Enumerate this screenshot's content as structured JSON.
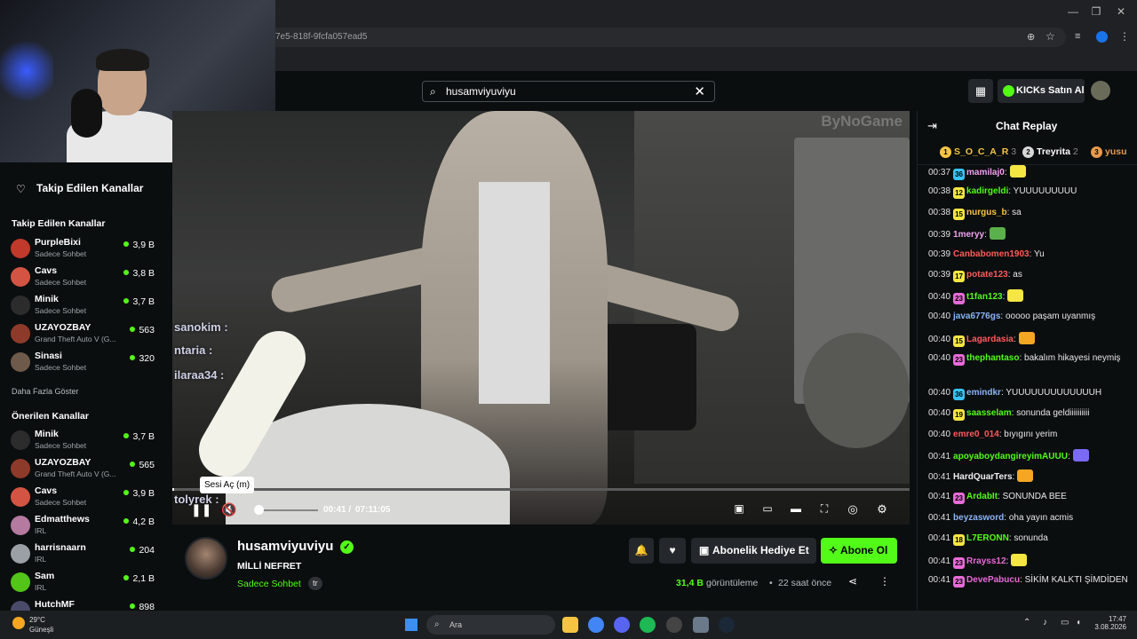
{
  "browser": {
    "url_fragment": "7e5-818f-9fcfa057ead5",
    "window_controls": [
      "—",
      "❐",
      "✕"
    ]
  },
  "header": {
    "search_value": "husamviyuviyu",
    "kicks_label": "KICKs Satın Al"
  },
  "sidebar": {
    "title": "Takip Edilen Kanallar",
    "followed_section": "Takip Edilen Kanallar",
    "followed": [
      {
        "name": "PurpleBixi",
        "sub": "Sadece Sohbet",
        "viewers": "3,9 B"
      },
      {
        "name": "Cavs",
        "sub": "Sadece Sohbet",
        "viewers": "3,8 B"
      },
      {
        "name": "Minik",
        "sub": "Sadece Sohbet",
        "viewers": "3,7 B"
      },
      {
        "name": "UZAYOZBAY",
        "sub": "Grand Theft Auto V (G...",
        "viewers": "563"
      },
      {
        "name": "Sinasi",
        "sub": "Sadece Sohbet",
        "viewers": "320"
      }
    ],
    "show_more": "Daha Fazla Göster",
    "recommended_section": "Önerilen Kanallar",
    "recommended": [
      {
        "name": "Minik",
        "sub": "Sadece Sohbet",
        "viewers": "3,7 B"
      },
      {
        "name": "UZAYOZBAY",
        "sub": "Grand Theft Auto V (G...",
        "viewers": "565"
      },
      {
        "name": "Cavs",
        "sub": "Sadece Sohbet",
        "viewers": "3,9 B"
      },
      {
        "name": "Edmatthews",
        "sub": "IRL",
        "viewers": "4,2 B"
      },
      {
        "name": "harrisnaarn",
        "sub": "IRL",
        "viewers": "204"
      },
      {
        "name": "Sam",
        "sub": "IRL",
        "viewers": "2,1 B"
      },
      {
        "name": "HutchMF",
        "sub": "",
        "viewers": "898"
      }
    ]
  },
  "video": {
    "brand_overlay": "ByNoGame",
    "overlay_chat": [
      "sanokim :",
      "ntaria :",
      "ilaraa34 :",
      "tolyrek :"
    ],
    "tooltip": "Sesi Aç (m)",
    "time_current": "00:41",
    "time_separator": "/",
    "time_total": "07:11:05",
    "progress": 0.002
  },
  "channel": {
    "name": "husamviyuviyu",
    "title": "MİLLİ NEFRET",
    "category": "Sadece Sohbet",
    "language": "tr",
    "gift_label": "Abonelik Hediye Et",
    "subscribe_label": "Abone Ol",
    "views_count": "31,4 B",
    "views_label": "görüntüleme",
    "bullet": "•",
    "ago": "22 saat önce"
  },
  "chat": {
    "title": "Chat Replay",
    "leaderboard": [
      {
        "rank": "1",
        "name": "S_O_C_A_R",
        "count": "3",
        "color": "#f5c542"
      },
      {
        "rank": "2",
        "name": "Treyrita",
        "count": "2",
        "color": "#d8d8d8"
      },
      {
        "rank": "3",
        "name": "yusu",
        "count": "",
        "color": "#e89a4a"
      }
    ],
    "messages": [
      {
        "time": "00:37",
        "badge": "36",
        "badge_color": "#36c3f5",
        "user": "mamilaj0",
        "user_color": "#f0a0f0",
        "text": ":"
      },
      {
        "time": "00:38",
        "badge": "12",
        "badge_color": "#f5e642",
        "user": "kadirgeldi",
        "user_color": "#53fc18",
        "text": ": YUUUUUUUUU"
      },
      {
        "time": "00:38",
        "badge": "15",
        "badge_color": "#f5e642",
        "user": "nurgus_b",
        "user_color": "#f5c542",
        "text": ": sa"
      },
      {
        "time": "00:39",
        "badge": "",
        "badge_color": "",
        "user": "1meryy",
        "user_color": "#f0a0f0",
        "text": ":"
      },
      {
        "time": "00:39",
        "badge": "",
        "badge_color": "",
        "user": "Canbabomen1903",
        "user_color": "#ff5a5a",
        "text": ": Yu"
      },
      {
        "time": "00:39",
        "badge": "17",
        "badge_color": "#f5e642",
        "user": "potate123",
        "user_color": "#ff5a5a",
        "text": ": as"
      },
      {
        "time": "00:40",
        "badge": "23",
        "badge_color": "#e86ad8",
        "user": "t1fan123",
        "user_color": "#53fc18",
        "text": ":"
      },
      {
        "time": "00:40",
        "badge": "",
        "badge_color": "",
        "user": "java6776gs",
        "user_color": "#8ab4f8",
        "text": ": ooooo paşam uyanmış"
      },
      {
        "time": "00:40",
        "badge": "15",
        "badge_color": "#f5e642",
        "user": "Lagardasia",
        "user_color": "#ff5a5a",
        "text": ":"
      },
      {
        "time": "00:40",
        "badge": "23",
        "badge_color": "#e86ad8",
        "user": "thephantaso",
        "user_color": "#53fc18",
        "text": ": bakalım hikayesi neymiş"
      },
      {
        "time": "00:40",
        "badge": "36",
        "badge_color": "#36c3f5",
        "user": "emindkr",
        "user_color": "#8ab4f8",
        "text": ": YUUUUUUUUUUUUUH"
      },
      {
        "time": "00:40",
        "badge": "19",
        "badge_color": "#f5e642",
        "user": "saasselam",
        "user_color": "#53fc18",
        "text": ": sonunda geldiiiiiiiiii"
      },
      {
        "time": "00:40",
        "badge": "",
        "badge_color": "",
        "user": "emre0_014",
        "user_color": "#ff5a5a",
        "text": ": bıyıgını yerim"
      },
      {
        "time": "00:41",
        "badge": "",
        "badge_color": "",
        "user": "apoyaboydangireyimAUUU",
        "user_color": "#53fc18",
        "text": ":"
      },
      {
        "time": "00:41",
        "badge": "",
        "badge_color": "",
        "user": "HardQuarTers",
        "user_color": "#f0f0f0",
        "text": ":"
      },
      {
        "time": "00:41",
        "badge": "23",
        "badge_color": "#e86ad8",
        "user": "ArdabIt",
        "user_color": "#53fc18",
        "text": ": SONUNDA BEE"
      },
      {
        "time": "00:41",
        "badge": "",
        "badge_color": "",
        "user": "beyzasword",
        "user_color": "#8ab4f8",
        "text": ": oha yayın acmis"
      },
      {
        "time": "00:41",
        "badge": "18",
        "badge_color": "#f5e642",
        "user": "L7ERONN",
        "user_color": "#53fc18",
        "text": ": sonunda"
      },
      {
        "time": "00:41",
        "badge": "23",
        "badge_color": "#e86ad8",
        "user": "Rrayss12",
        "user_color": "#e86ad8",
        "text": ":"
      },
      {
        "time": "00:41",
        "badge": "23",
        "badge_color": "#e86ad8",
        "user": "DevePabucu",
        "user_color": "#e86ad8",
        "text": ": SİKİM KALKTI ŞİMDİDEN"
      }
    ]
  },
  "taskbar": {
    "temperature": "29°C",
    "weather": "Güneşli",
    "search": "Ara",
    "time": "17:47",
    "date": "3.08.2026"
  }
}
